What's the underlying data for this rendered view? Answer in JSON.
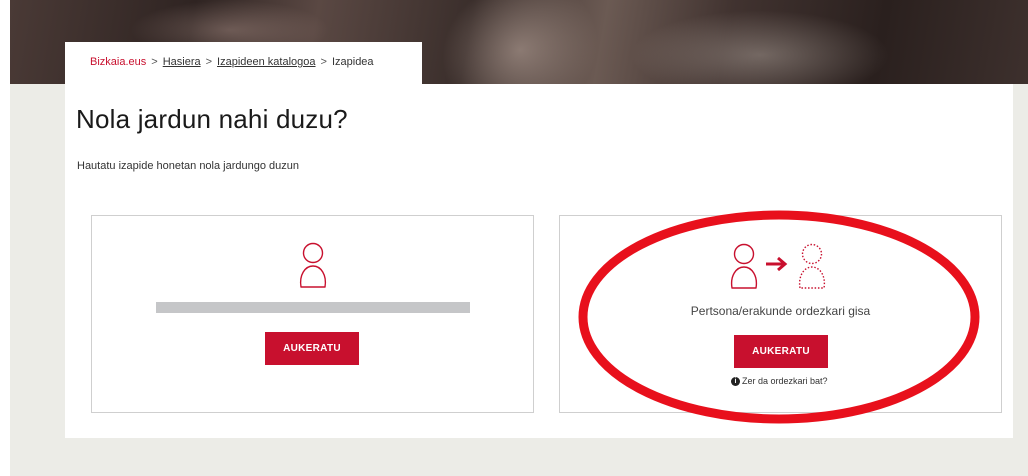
{
  "breadcrumb": {
    "home": "Bizkaia.eus",
    "separator": ">",
    "items": [
      "Hasiera",
      "Izapideen katalogoa"
    ],
    "current": "Izapidea"
  },
  "page": {
    "title": "Nola jardun nahi duzu?",
    "subtitle": "Hautatu izapide honetan nola jardungo duzun"
  },
  "options": {
    "self": {
      "icon": "person-icon",
      "button_label": "AUKERATU"
    },
    "representative": {
      "icon": "person-to-representative-icon",
      "label": "Pertsona/erakunde ordezkari gisa",
      "button_label": "AUKERATU",
      "help_icon": "info-icon",
      "help_text": "Zer da ordezkari bat?"
    }
  },
  "colors": {
    "accent": "#c8102e",
    "annotation": "#e8101c",
    "background": "#ecece7",
    "placeholder_bar": "#c5c6c8"
  }
}
